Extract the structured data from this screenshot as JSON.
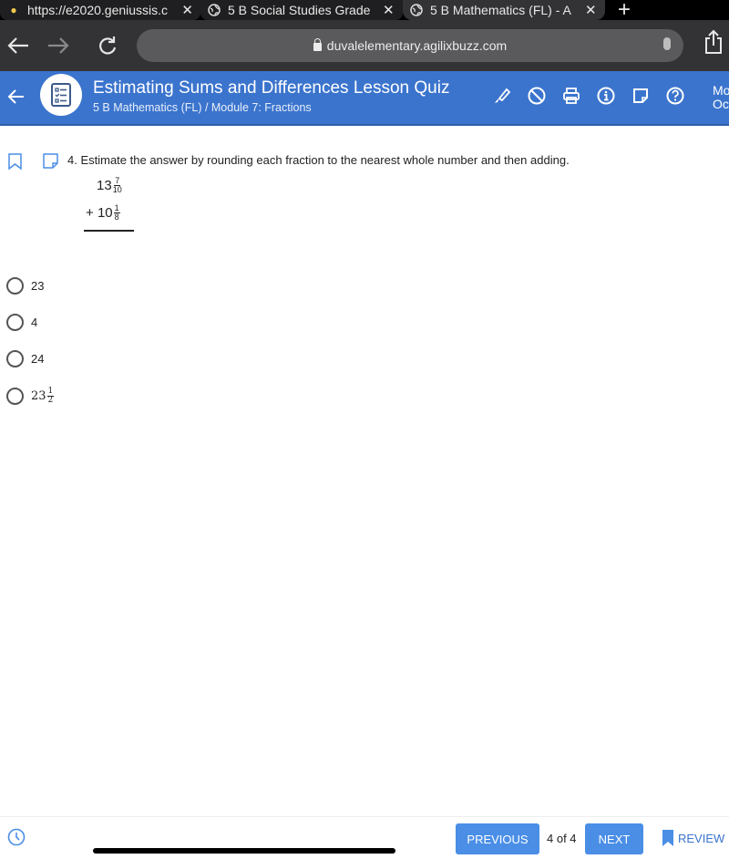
{
  "browser": {
    "tabs": [
      {
        "title": "https://e2020.geniussis.c",
        "icon": "lightbulb-icon",
        "active": false
      },
      {
        "title": "5 B Social Studies Grade",
        "icon": "globe-icon",
        "active": false
      },
      {
        "title": "5 B Mathematics (FL) - A",
        "icon": "globe-icon",
        "active": true
      }
    ],
    "new_tab_label": "+",
    "close_label": "✕",
    "url": "duvalelementary.agilixbuzz.com"
  },
  "appbar": {
    "title": "Estimating Sums and Differences Lesson Quiz",
    "breadcrumb": "5 B Mathematics (FL) / Module 7: Fractions",
    "right_line1": "Mo",
    "right_line2": "Oc",
    "tools": [
      "highlighter-icon",
      "block-icon",
      "print-icon",
      "info-icon",
      "sticky-note-icon",
      "help-icon"
    ]
  },
  "question": {
    "number": "4.",
    "text": "4. Estimate the answer by rounding each fraction to the nearest whole number and then adding.",
    "addend1": {
      "whole": "13",
      "num": "7",
      "den": "10"
    },
    "addend2": {
      "prefix": "+ ",
      "whole": "10",
      "num": "1",
      "den": "8"
    }
  },
  "options": [
    {
      "label": "23"
    },
    {
      "label": "4"
    },
    {
      "label": "24"
    },
    {
      "label": "23",
      "num": "1",
      "den": "2"
    }
  ],
  "footer": {
    "previous_label": "PREVIOUS",
    "page_indicator": "4 of 4",
    "next_label": "NEXT",
    "review_label": "REVIEW"
  },
  "colors": {
    "appbar": "#3b74cd",
    "button": "#4a8ee6",
    "accent": "#3b74cd"
  }
}
